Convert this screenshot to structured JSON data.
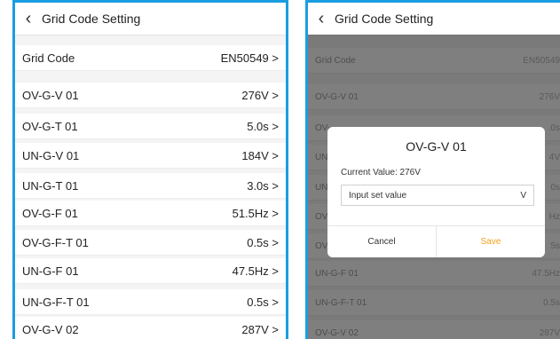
{
  "left": {
    "header": {
      "back_icon": "chevron-left-icon",
      "title": "Grid Code Setting"
    },
    "rows": [
      {
        "label": "Grid Code",
        "value": "EN50549 >"
      },
      {
        "label": "OV-G-V 01",
        "value": "276V >"
      },
      {
        "label": "OV-G-T 01",
        "value": "5.0s >"
      },
      {
        "label": "UN-G-V 01",
        "value": "184V >"
      },
      {
        "label": "UN-G-T 01",
        "value": "3.0s >"
      },
      {
        "label": "OV-G-F 01",
        "value": "51.5Hz >"
      },
      {
        "label": "OV-G-F-T 01",
        "value": "0.5s >"
      },
      {
        "label": "UN-G-F 01",
        "value": "47.5Hz >"
      },
      {
        "label": "UN-G-F-T 01",
        "value": "0.5s >"
      },
      {
        "label": "OV-G-V 02",
        "value": "287V >"
      }
    ]
  },
  "right": {
    "header": {
      "back_icon": "chevron-left-icon",
      "title": "Grid Code Setting"
    },
    "rows": [
      {
        "label": "Grid Code",
        "value": "EN50549"
      },
      {
        "label": "OV-G-V 01",
        "value": "276V"
      },
      {
        "label": "OV-",
        "value": ".0s"
      },
      {
        "label": "UN-",
        "value": "4V"
      },
      {
        "label": "UN-",
        "value": "0s"
      },
      {
        "label": "OV-",
        "value": "Hz"
      },
      {
        "label": "OV-",
        "value": "5s"
      },
      {
        "label": "UN-G-F 01",
        "value": "47.5Hz"
      },
      {
        "label": "UN-G-F-T 01",
        "value": "0.5s"
      },
      {
        "label": "OV-G-V 02",
        "value": "287V"
      }
    ],
    "dialog": {
      "title": "OV-G-V 01",
      "current_value": "Current Value: 276V",
      "input_placeholder": "Input set value",
      "input_unit": "V",
      "cancel_label": "Cancel",
      "save_label": "Save",
      "save_color": "#f5a11f"
    }
  }
}
